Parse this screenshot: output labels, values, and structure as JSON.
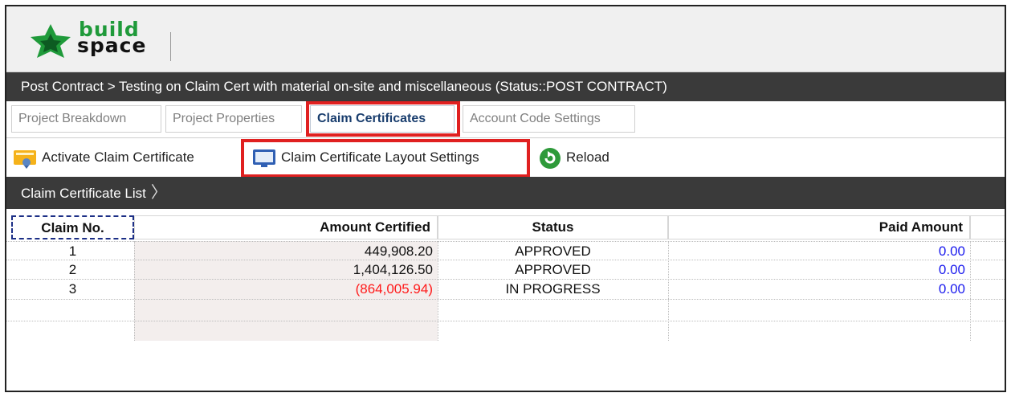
{
  "app": {
    "logo_top": "build",
    "logo_bottom": "space"
  },
  "breadcrumb": "Post Contract > Testing on Claim Cert with material on-site and miscellaneous (Status::POST CONTRACT)",
  "tabs": [
    {
      "label": "Project Breakdown",
      "active": false
    },
    {
      "label": "Project Properties",
      "active": false
    },
    {
      "label": "Claim Certificates",
      "active": true
    },
    {
      "label": "Account Code Settings",
      "active": false
    }
  ],
  "toolbar": {
    "activate_label": "Activate Claim Certificate",
    "activate_icon": "certificate-icon",
    "layout_label": "Claim Certificate Layout Settings",
    "layout_icon": "monitor-icon",
    "reload_label": "Reload",
    "reload_icon": "reload-icon"
  },
  "list_title": "Claim Certificate List",
  "table": {
    "columns": [
      "Claim No.",
      "Amount Certified",
      "Status",
      "Paid Amount"
    ],
    "rows": [
      {
        "claim_no": "1",
        "amount": "449,908.20",
        "status": "APPROVED",
        "paid": "0.00"
      },
      {
        "claim_no": "2",
        "amount": "1,404,126.50",
        "status": "APPROVED",
        "paid": "0.00"
      },
      {
        "claim_no": "3",
        "amount": "(864,005.94)",
        "status": "IN PROGRESS",
        "paid": "0.00"
      }
    ]
  },
  "colors": {
    "negative_amount": "#ff1a1a",
    "paid_amount": "#1a1aee",
    "highlight": "#e02020",
    "dark_bar": "#3a3a3a",
    "logo_green": "#1f9a3a"
  }
}
